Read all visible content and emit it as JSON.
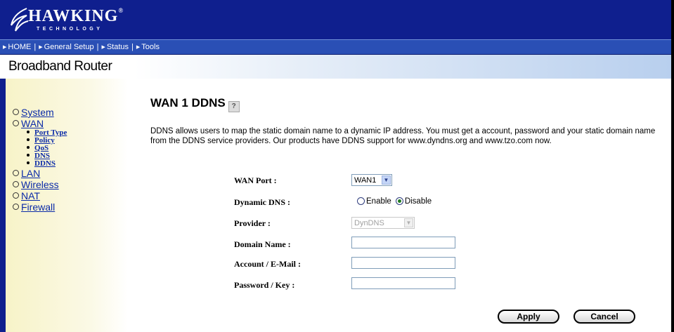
{
  "header": {
    "logo_main": "HAWKING",
    "logo_reg": "®",
    "logo_sub": "TECHNOLOGY"
  },
  "nav": {
    "items": [
      {
        "label": "HOME"
      },
      {
        "label": "General Setup"
      },
      {
        "label": "Status"
      },
      {
        "label": "Tools"
      }
    ],
    "separator": "|"
  },
  "subheader": {
    "title": "Broadband Router"
  },
  "sidebar": {
    "items": [
      {
        "label": "System"
      },
      {
        "label": "WAN",
        "subitems": [
          {
            "label": "Port Type"
          },
          {
            "label": "Policy"
          },
          {
            "label": "QoS"
          },
          {
            "label": "DNS"
          },
          {
            "label": "DDNS"
          }
        ]
      },
      {
        "label": "LAN"
      },
      {
        "label": "Wireless"
      },
      {
        "label": "NAT"
      },
      {
        "label": "Firewall"
      }
    ]
  },
  "main": {
    "title": "WAN 1 DDNS",
    "help_glyph": "?",
    "description": "DDNS allows users to map the static domain name to a dynamic IP address. You must get a account, password and your static domain name from the DDNS service providers. Our products have DDNS support for www.dyndns.org and www.tzo.com now.",
    "form": {
      "wan_port_label": "WAN Port :",
      "wan_port_value": "WAN1",
      "dynamic_dns_label": "Dynamic DNS :",
      "enable_label": "Enable",
      "disable_label": "Disable",
      "dynamic_dns_selected": "Disable",
      "provider_label": "Provider :",
      "provider_value": "DynDNS",
      "domain_label": "Domain Name :",
      "domain_value": "",
      "account_label": "Account / E-Mail :",
      "account_value": "",
      "password_label": "Password / Key :",
      "password_value": ""
    },
    "buttons": {
      "apply": "Apply",
      "cancel": "Cancel"
    }
  },
  "colors": {
    "header_bg": "#0f1f8e",
    "nav_bg": "#2a4fb5",
    "sidebar_bg": "#f7f3c8",
    "link": "#0a2aa8"
  }
}
